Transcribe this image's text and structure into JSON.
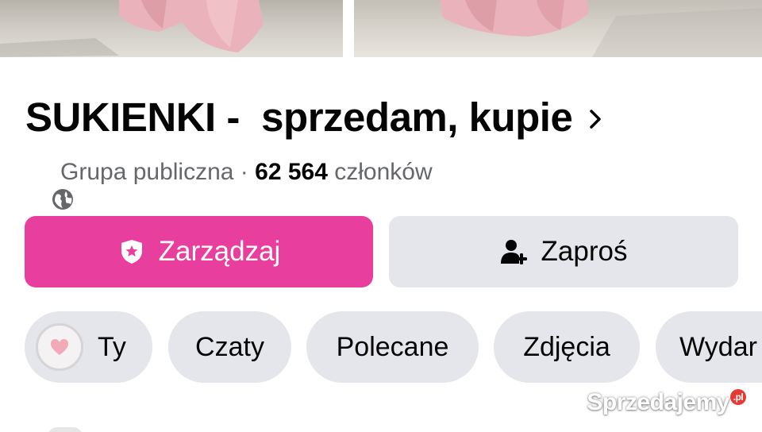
{
  "header": {
    "group_name": "SUKIENKI -  sprzedam, kupie",
    "privacy": "Grupa publiczna",
    "separator": " · ",
    "member_count": "62 564",
    "member_suffix": " członków"
  },
  "actions": {
    "manage_label": "Zarządzaj",
    "invite_label": "Zaproś"
  },
  "tabs": [
    {
      "label": "Ty"
    },
    {
      "label": "Czaty"
    },
    {
      "label": "Polecane"
    },
    {
      "label": "Zdjęcia"
    },
    {
      "label": "Wydar"
    }
  ],
  "watermark": {
    "text": "Sprzedajemy",
    "badge": ".pl"
  },
  "colors": {
    "accent": "#e83e9d",
    "chip_bg": "#e4e6eb",
    "secondary_text": "#65676b"
  },
  "icons": {
    "chevron": "chevron-right-icon",
    "globe": "globe-icon",
    "manage": "shield-star-icon",
    "invite": "add-person-icon",
    "you_avatar": "heart-avatar-icon"
  }
}
